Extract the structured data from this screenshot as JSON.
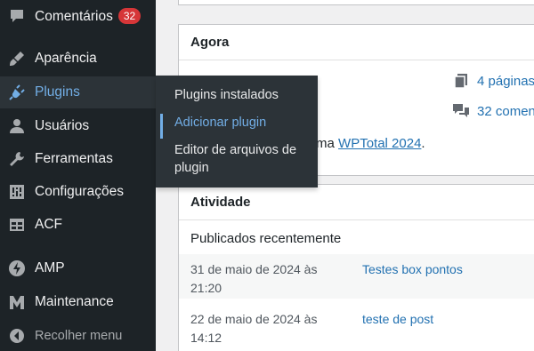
{
  "sidebar": {
    "items": [
      {
        "label": "Comentários",
        "icon": "comment-icon",
        "badge": "32"
      },
      {
        "label": "Aparência",
        "icon": "paintbrush-icon"
      },
      {
        "label": "Plugins",
        "icon": "plug-icon"
      },
      {
        "label": "Usuários",
        "icon": "user-icon"
      },
      {
        "label": "Ferramentas",
        "icon": "wrench-icon"
      },
      {
        "label": "Configurações",
        "icon": "sliders-icon"
      },
      {
        "label": "ACF",
        "icon": "table-icon"
      },
      {
        "label": "AMP",
        "icon": "bolt-icon"
      },
      {
        "label": "Maintenance",
        "icon": "m-logo-icon"
      }
    ],
    "collapse_label": "Recolher menu",
    "active": "Plugins",
    "accent": "#72aee6",
    "background": "#1d2327"
  },
  "plugins_flyout": {
    "items": [
      {
        "label": "Plugins instalados"
      },
      {
        "label": "Adicionar plugin"
      },
      {
        "label": "Editor de arquivos de plugin"
      }
    ],
    "current": "Adicionar plugin"
  },
  "at_a_glance": {
    "title": "Agora",
    "pages": "4 páginas",
    "comments": "32 comen",
    "theme_text": "o tema",
    "theme_link": "WPTotal 2024",
    "theme_suffix": "."
  },
  "activity": {
    "title": "Atividade",
    "recent_title": "Publicados recentemente",
    "posts": [
      {
        "date": "31 de maio de 2024 às 21:20",
        "title": "Testes box pontos"
      },
      {
        "date": "22 de maio de 2024 às 14:12",
        "title": "teste de post"
      }
    ]
  }
}
